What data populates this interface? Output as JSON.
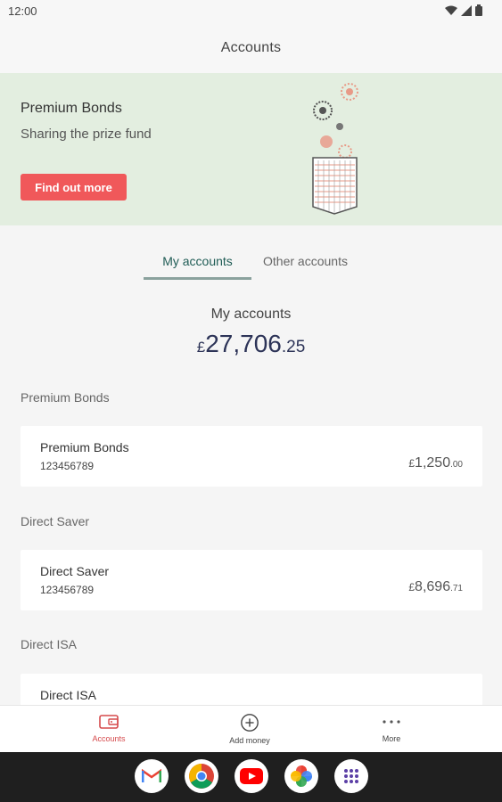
{
  "status": {
    "time": "12:00"
  },
  "appbar": {
    "title": "Accounts"
  },
  "banner": {
    "title": "Premium Bonds",
    "subtitle": "Sharing the prize fund",
    "cta": "Find out more"
  },
  "tabs": [
    {
      "label": "My accounts",
      "active": true
    },
    {
      "label": "Other accounts",
      "active": false
    }
  ],
  "summary": {
    "label": "My accounts",
    "currency": "£",
    "main": "27,706",
    "decimal": ".25"
  },
  "sections": [
    {
      "heading": "Premium Bonds",
      "account": {
        "name": "Premium Bonds",
        "number": "123456789",
        "currency": "£",
        "main": "1,250",
        "decimal": ".00"
      }
    },
    {
      "heading": "Direct Saver",
      "account": {
        "name": "Direct Saver",
        "number": "123456789",
        "currency": "£",
        "main": "8,696",
        "decimal": ".71"
      }
    },
    {
      "heading": "Direct ISA",
      "account": {
        "name": "Direct ISA",
        "number": "",
        "currency": "£",
        "main": "",
        "decimal": ""
      }
    }
  ],
  "nav": [
    {
      "label": "Accounts",
      "icon": "wallet-icon",
      "active": true
    },
    {
      "label": "Add money",
      "icon": "plus-circle-icon",
      "active": false
    },
    {
      "label": "More",
      "icon": "more-horizontal-icon",
      "active": false
    }
  ],
  "dock": [
    "gmail-icon",
    "chrome-icon",
    "youtube-icon",
    "photos-icon",
    "app-drawer-icon"
  ],
  "colors": {
    "accent": "#f0585a",
    "banner_bg": "#e3eee0",
    "tab_active": "#1f5c55",
    "total_text": "#2c3357"
  }
}
